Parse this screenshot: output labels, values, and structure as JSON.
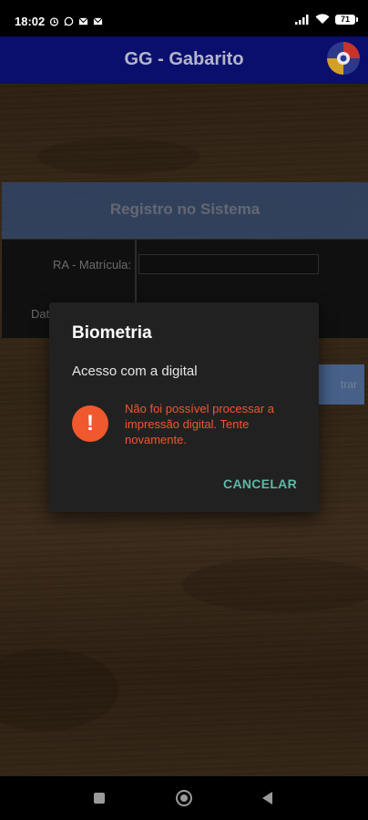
{
  "status_bar": {
    "time": "18:02",
    "battery": "71",
    "icons": [
      "alarm-icon",
      "whatsapp-icon",
      "mail-icon",
      "mail-icon",
      "signal-icon",
      "wifi-icon",
      "battery-icon"
    ]
  },
  "app_bar": {
    "title": "GG - Gabarito",
    "logo_icon": "app-logo"
  },
  "form": {
    "header": "Registro no Sistema",
    "fields": [
      {
        "label": "RA - Matrícula:",
        "value": ""
      },
      {
        "label": "Dat",
        "value": ""
      }
    ],
    "register_button_visible_text": "trar"
  },
  "dialog": {
    "title": "Biometria",
    "subtitle": "Acesso com a digital",
    "error_icon": "!",
    "error_message": "Não foi possível processar a impressão digital. Tente novamente.",
    "cancel_label": "CANCELAR",
    "colors": {
      "error": "#f0582d",
      "action": "#5fb8a7",
      "background": "#212121"
    }
  },
  "nav_bar": {
    "buttons": [
      "recent-apps",
      "home",
      "back"
    ]
  }
}
